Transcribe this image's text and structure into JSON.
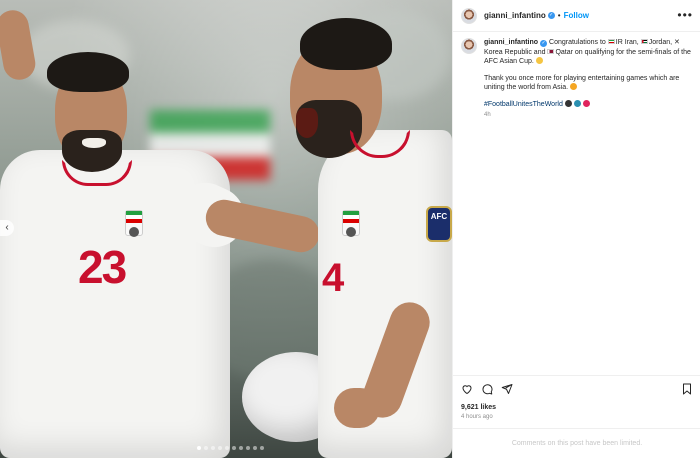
{
  "post": {
    "username": "gianni_infantino",
    "separator": "•",
    "follow_label": "Follow",
    "more_label": "•••"
  },
  "photo": {
    "left_player_number": "23",
    "right_player_number": "4",
    "patch_text": "AFC",
    "carousel_dots": 10,
    "active_dot": 0
  },
  "caption": {
    "username": "gianni_infantino",
    "line1_a": "Congratulations to",
    "iran": "IR Iran,",
    "jordan": "Jordan,",
    "korea": "Korea Republic and",
    "qatar": "Qatar on qualifying for the semi-finals of the AFC Asian Cup.",
    "line2": "Thank you once more for playing entertaining games which are uniting the world from Asia.",
    "hashtag": "#FootballUnitesTheWorld",
    "time_ago": "4h"
  },
  "engagement": {
    "likes": "9,621 likes",
    "posted": "4 hours ago",
    "comments_limited": "Comments on this post have been limited."
  },
  "colors": {
    "accent": "#0095f6",
    "hashtag": "#00376b",
    "muted": "#8e8e8e",
    "jersey_red": "#c8102e"
  }
}
